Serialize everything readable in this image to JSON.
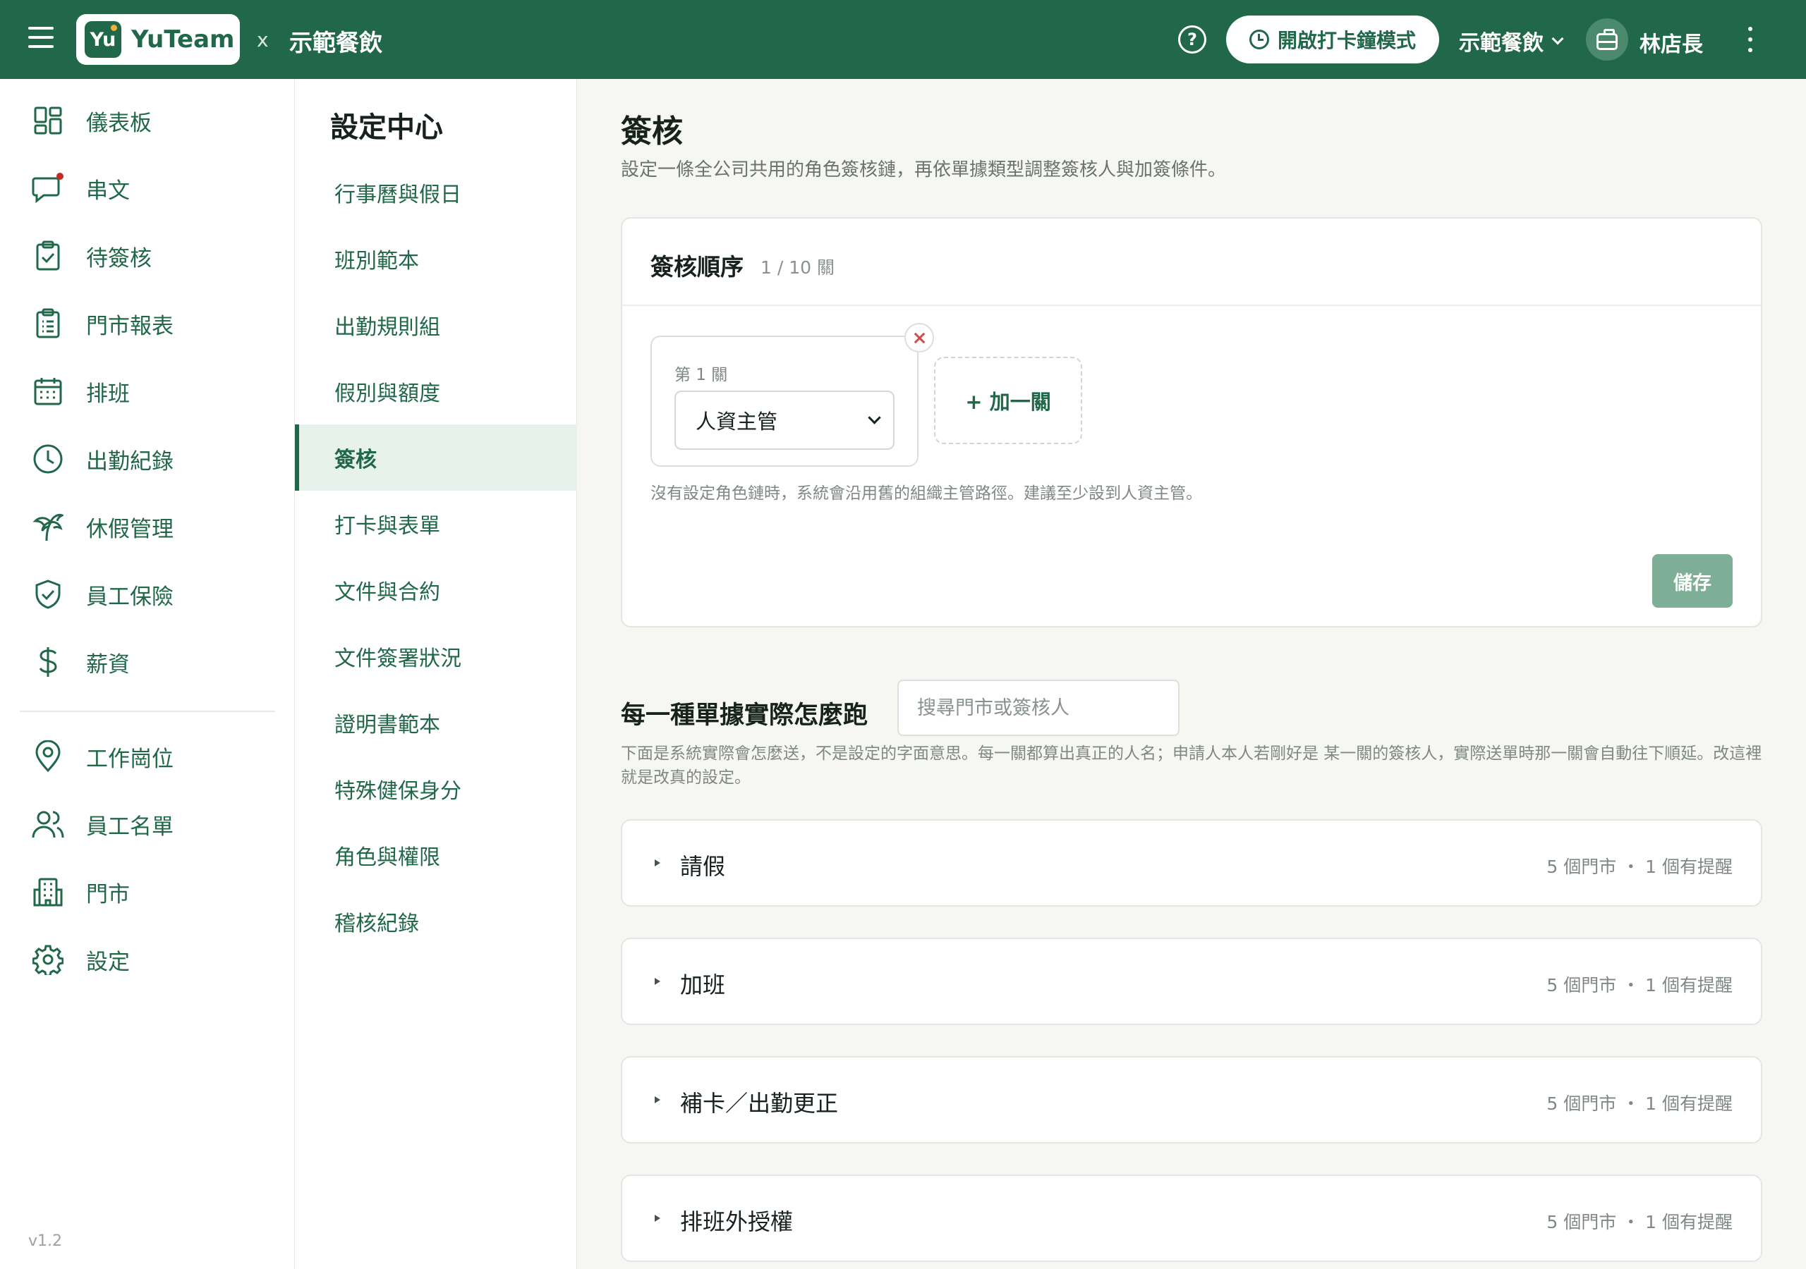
{
  "header": {
    "brand_mark": "Yu",
    "brand_name": "YuTeam",
    "separator": "x",
    "company": "示範餐飲",
    "clock_mode_label": "開啟打卡鐘模式",
    "store_switch": "示範餐飲",
    "user_name": "林店長"
  },
  "sidebar": {
    "items": [
      {
        "label": "儀表板",
        "icon": "dashboard-grid-icon"
      },
      {
        "label": "串文",
        "icon": "chat-bubble-icon"
      },
      {
        "label": "待簽核",
        "icon": "clipboard-check-icon"
      },
      {
        "label": "門市報表",
        "icon": "clipboard-list-icon"
      },
      {
        "label": "排班",
        "icon": "calendar-icon"
      },
      {
        "label": "出勤紀錄",
        "icon": "clock-icon"
      },
      {
        "label": "休假管理",
        "icon": "palm-tree-icon"
      },
      {
        "label": "員工保險",
        "icon": "shield-check-icon"
      },
      {
        "label": "薪資",
        "icon": "dollar-icon"
      },
      {
        "label": "工作崗位",
        "icon": "map-pin-icon"
      },
      {
        "label": "員工名單",
        "icon": "users-icon"
      },
      {
        "label": "門市",
        "icon": "building-icon"
      },
      {
        "label": "設定",
        "icon": "gear-icon"
      }
    ],
    "version": "v1.2"
  },
  "settings_menu": {
    "title": "設定中心",
    "items": [
      {
        "label": "行事曆與假日"
      },
      {
        "label": "班別範本"
      },
      {
        "label": "出勤規則組"
      },
      {
        "label": "假別與額度"
      },
      {
        "label": "簽核",
        "active": true
      },
      {
        "label": "打卡與表單"
      },
      {
        "label": "文件與合約"
      },
      {
        "label": "文件簽署狀況"
      },
      {
        "label": "證明書範本"
      },
      {
        "label": "特殊健保身分"
      },
      {
        "label": "角色與權限"
      },
      {
        "label": "稽核紀錄"
      }
    ]
  },
  "main": {
    "title": "簽核",
    "subtitle": "設定一條全公司共用的角色簽核鏈，再依單據類型調整簽核人與加簽條件。",
    "chain": {
      "title": "簽核順序",
      "count": "1 / 10 關",
      "step_label": "第 1 關",
      "step_role": "人資主管",
      "add_step": "+ 加一關",
      "note": "沒有設定角色鏈時，系統會沿用舊的組織主管路徑。建議至少設到人資主管。",
      "save": "儲存"
    },
    "flow": {
      "title": "每一種單據實際怎麼跑",
      "search_placeholder": "搜尋門市或簽核人",
      "description": "下面是系統實際會怎麼送，不是設定的字面意思。每一關都算出真正的人名；申請人本人若剛好是 某一關的簽核人，實際送單時那一關會自動往下順延。改這裡就是改真的設定。",
      "doc_types": [
        {
          "name": "請假",
          "meta": "5 個門市 ・ 1 個有提醒"
        },
        {
          "name": "加班",
          "meta": "5 個門市 ・ 1 個有提醒"
        },
        {
          "name": "補卡／出勤更正",
          "meta": "5 個門市 ・ 1 個有提醒"
        },
        {
          "name": "排班外授權",
          "meta": "5 個門市 ・ 1 個有提醒"
        }
      ]
    }
  },
  "colors": {
    "brand": "#21684a",
    "accent_light": "#e8f2ec",
    "save_disabled": "#7fae97",
    "danger": "#d24b4b",
    "notify_dot": "#c62828"
  }
}
